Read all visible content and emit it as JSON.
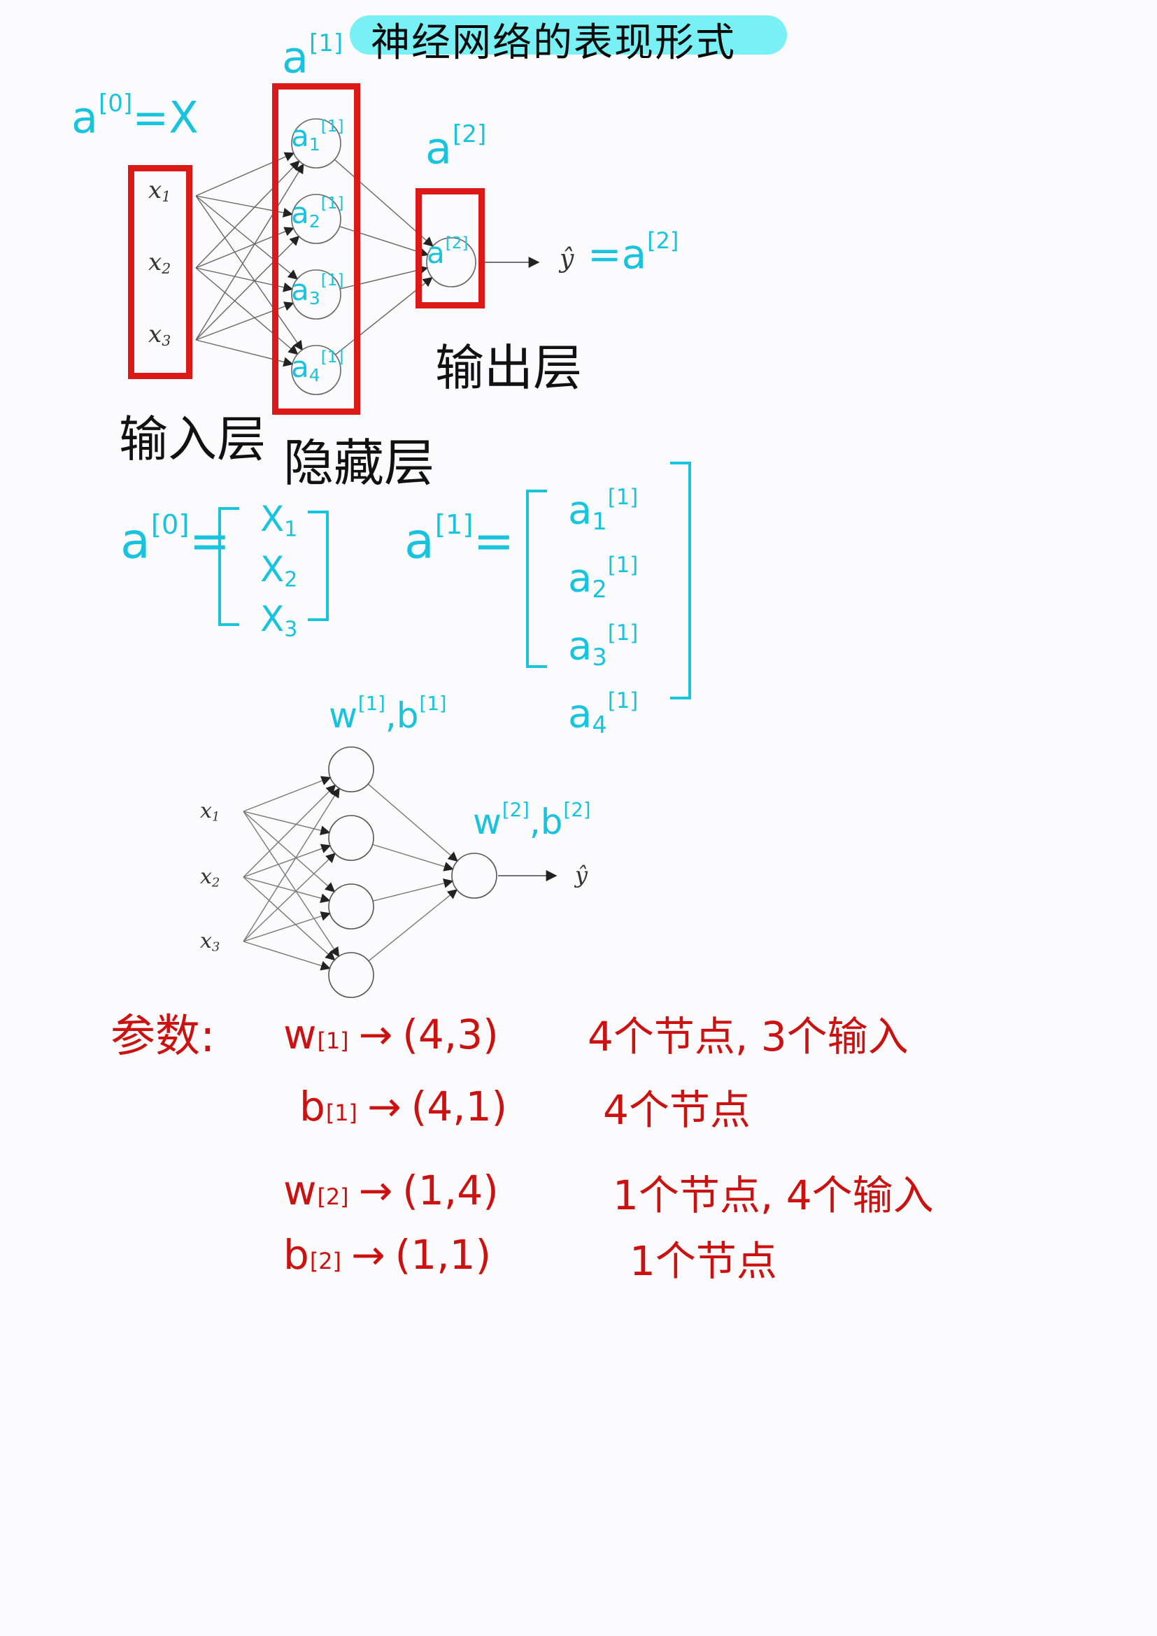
{
  "title": "神经网络的表现形式",
  "fig1": {
    "a1_label": "a",
    "a1_sup": "[1]",
    "a0_label": "a",
    "a0_sup": "[0]",
    "a0_eq": "=X",
    "a2_label": "a",
    "a2_sup": "[2]",
    "inputs": [
      {
        "base": "x",
        "sub": "1"
      },
      {
        "base": "x",
        "sub": "2"
      },
      {
        "base": "x",
        "sub": "3"
      }
    ],
    "hidden_nodes": [
      {
        "base": "a",
        "sub": "1",
        "sup": "[1]"
      },
      {
        "base": "a",
        "sub": "2",
        "sup": "[1]"
      },
      {
        "base": "a",
        "sub": "3",
        "sup": "[1]"
      },
      {
        "base": "a",
        "sub": "4",
        "sup": "[1]"
      }
    ],
    "output_node": {
      "base": "a",
      "sup": "[2]"
    },
    "yhat": "ŷ",
    "yhat_eq": "=a",
    "yhat_sup": "[2]",
    "input_layer_label": "输入层",
    "hidden_layer_label": "隐藏层",
    "output_layer_label": "输出层"
  },
  "vectors": {
    "a0": {
      "label": "a",
      "sup": "[0]",
      "eq": "=",
      "entries": [
        {
          "base": "X",
          "sub": "1"
        },
        {
          "base": "X",
          "sub": "2"
        },
        {
          "base": "X",
          "sub": "3"
        }
      ]
    },
    "a1": {
      "label": "a",
      "sup": "[1]",
      "eq": "=",
      "entries": [
        {
          "base": "a",
          "sub": "1",
          "sup": "[1]"
        },
        {
          "base": "a",
          "sub": "2",
          "sup": "[1]"
        },
        {
          "base": "a",
          "sub": "3",
          "sup": "[1]"
        },
        {
          "base": "a",
          "sub": "4",
          "sup": "[1]"
        }
      ]
    }
  },
  "fig2": {
    "inputs": [
      {
        "base": "x",
        "sub": "1"
      },
      {
        "base": "x",
        "sub": "2"
      },
      {
        "base": "x",
        "sub": "3"
      }
    ],
    "yhat": "ŷ",
    "layer1_params": {
      "w": "w",
      "w_sup": "[1]",
      "sep": ",",
      "b": "b",
      "b_sup": "[1]"
    },
    "layer2_params": {
      "w": "w",
      "w_sup": "[2]",
      "sep": ",",
      "b": "b",
      "b_sup": "[2]"
    }
  },
  "params": {
    "heading": "参数:",
    "rows": [
      {
        "sym": "w",
        "sup": "[1]",
        "arrow": "→",
        "shape": "(4,3)",
        "note": "4个节点, 3个输入"
      },
      {
        "sym": "b",
        "sup": "[1]",
        "arrow": "→",
        "shape": "(4,1)",
        "note": "4个节点"
      },
      {
        "sym": "w",
        "sup": "[2]",
        "arrow": "→",
        "shape": "(1,4)",
        "note": "1个节点, 4个输入"
      },
      {
        "sym": "b",
        "sup": "[2]",
        "arrow": "→",
        "shape": "(1,1)",
        "note": "1个节点"
      }
    ]
  }
}
